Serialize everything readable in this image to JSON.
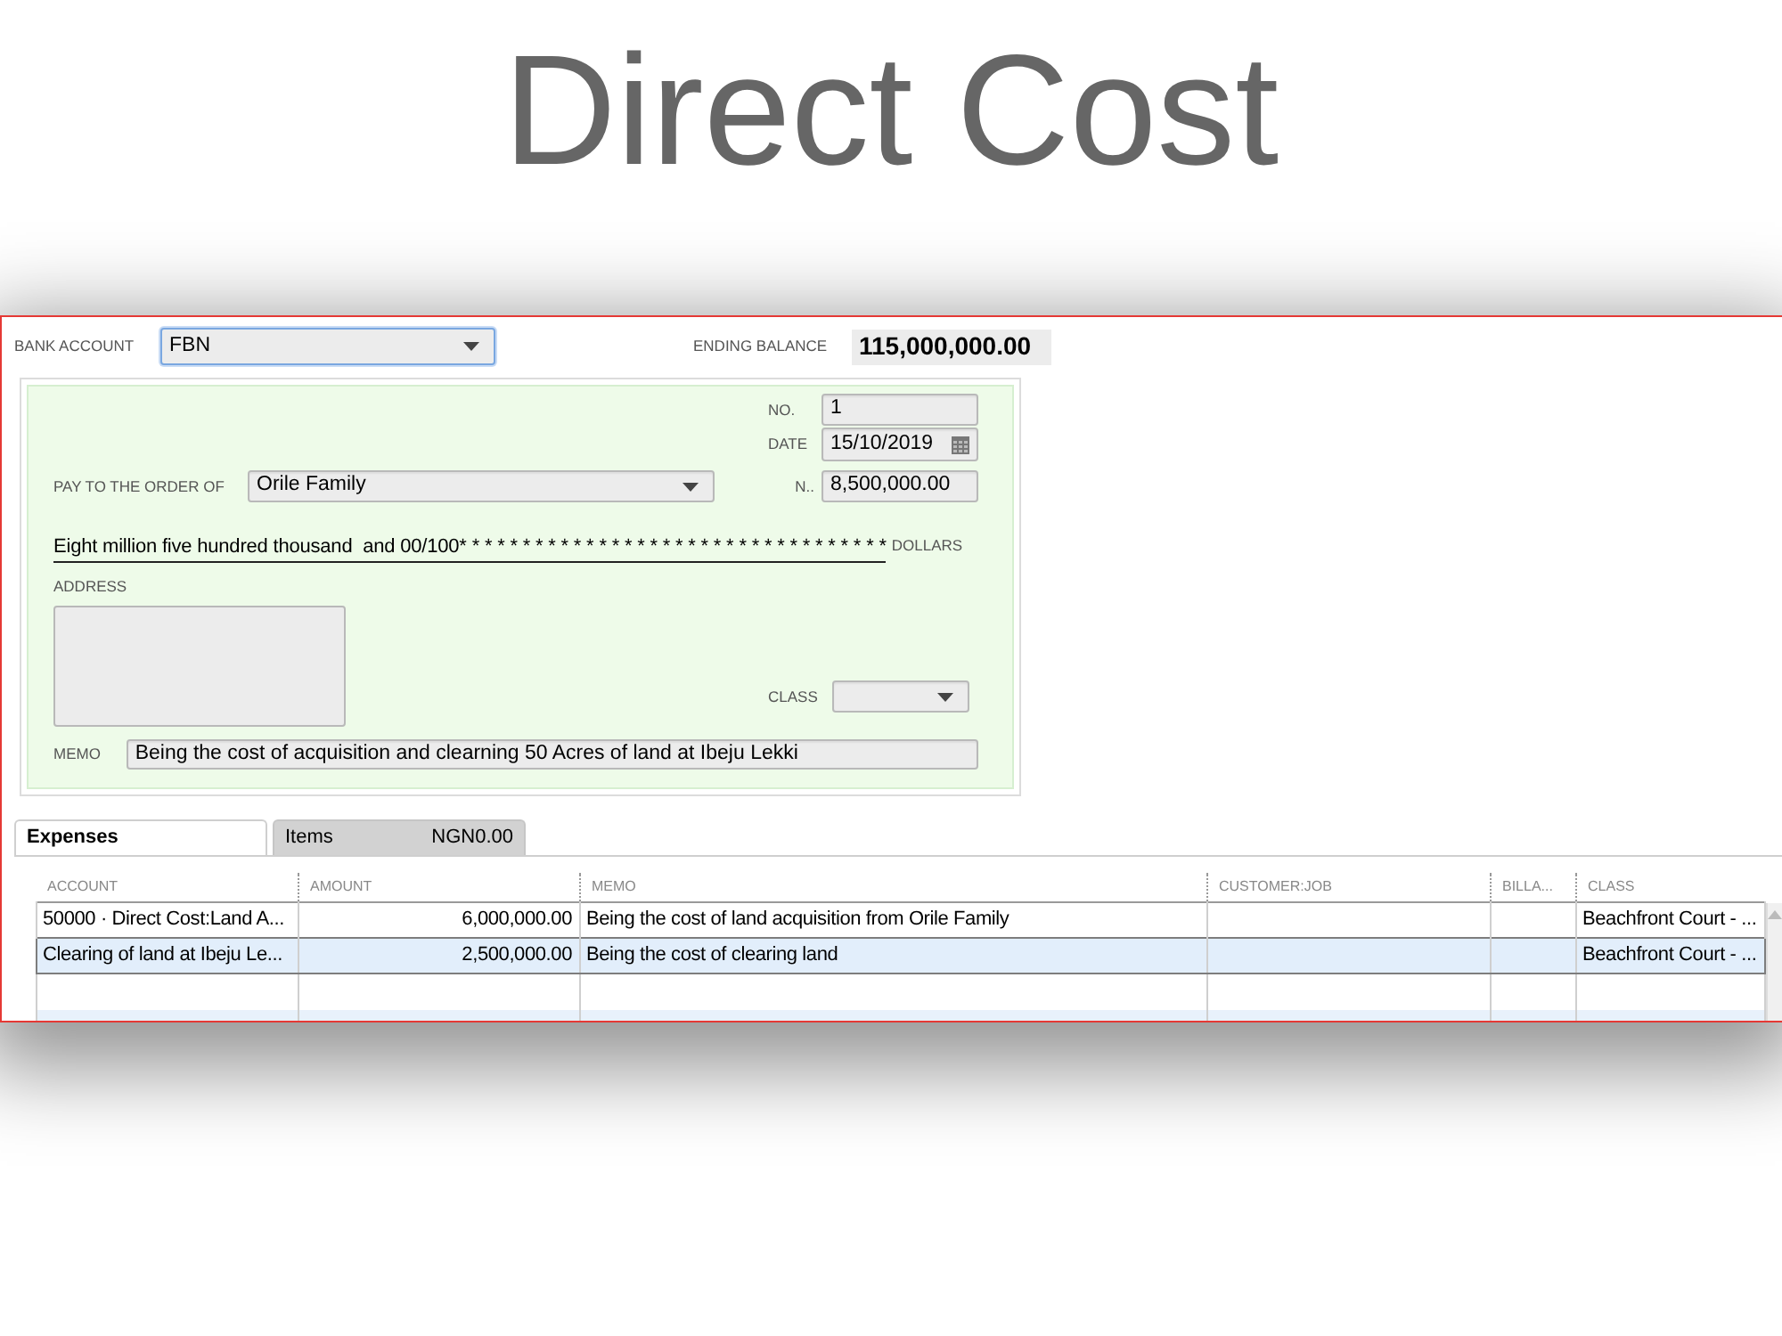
{
  "header": {
    "title": "Direct Cost"
  },
  "bank_account": {
    "label": "BANK ACCOUNT",
    "value": "FBN",
    "focused": true
  },
  "ending_balance": {
    "label": "ENDING BALANCE",
    "value": "115,000,000.00"
  },
  "check": {
    "number": {
      "label": "NO.",
      "value": "1"
    },
    "date": {
      "label": "DATE",
      "value": "15/10/2019"
    },
    "pay_to": {
      "label": "PAY TO THE ORDER OF",
      "value": "Orile Family"
    },
    "amount": {
      "label": "N..",
      "value": "8,500,000.00"
    },
    "amount_in_words": "Eight million five hundred thousand  and 00/100* * * * * * * * * * * * * * * * * * * * * * * * * * * * * * * * * *",
    "currency_label": "DOLLARS",
    "address": {
      "label": "ADDRESS"
    },
    "class": {
      "label": "CLASS"
    },
    "memo": {
      "label": "MEMO",
      "value": "Being the cost of acquisition and clearning 50 Acres of land at Ibeju Lekki"
    }
  },
  "tabs": [
    {
      "label": "Expenses",
      "selected": true
    },
    {
      "label": "Items",
      "amount": "NGN0.00",
      "selected": false
    }
  ],
  "table": {
    "columns": [
      {
        "label": "ACCOUNT",
        "kind": "text"
      },
      {
        "label": "AMOUNT",
        "kind": "money"
      },
      {
        "label": "MEMO",
        "kind": "text"
      },
      {
        "label": "CUSTOMER:JOB",
        "kind": "text"
      },
      {
        "label": "BILLA...",
        "kind": "text"
      },
      {
        "label": "CLASS",
        "kind": "text"
      }
    ],
    "rows": [
      {
        "cells": [
          "50000 · Direct Cost:Land A...",
          "6,000,000.00",
          "Being the cost of land acquisition from Orile Family",
          null,
          null,
          "Beachfront Court - ..."
        ],
        "selected": false
      },
      {
        "cells": [
          "Clearing of land at Ibeju Le...",
          "2,500,000.00",
          "Being the cost of clearing land",
          null,
          null,
          "Beachfront Court - ..."
        ],
        "selected": true
      }
    ]
  }
}
